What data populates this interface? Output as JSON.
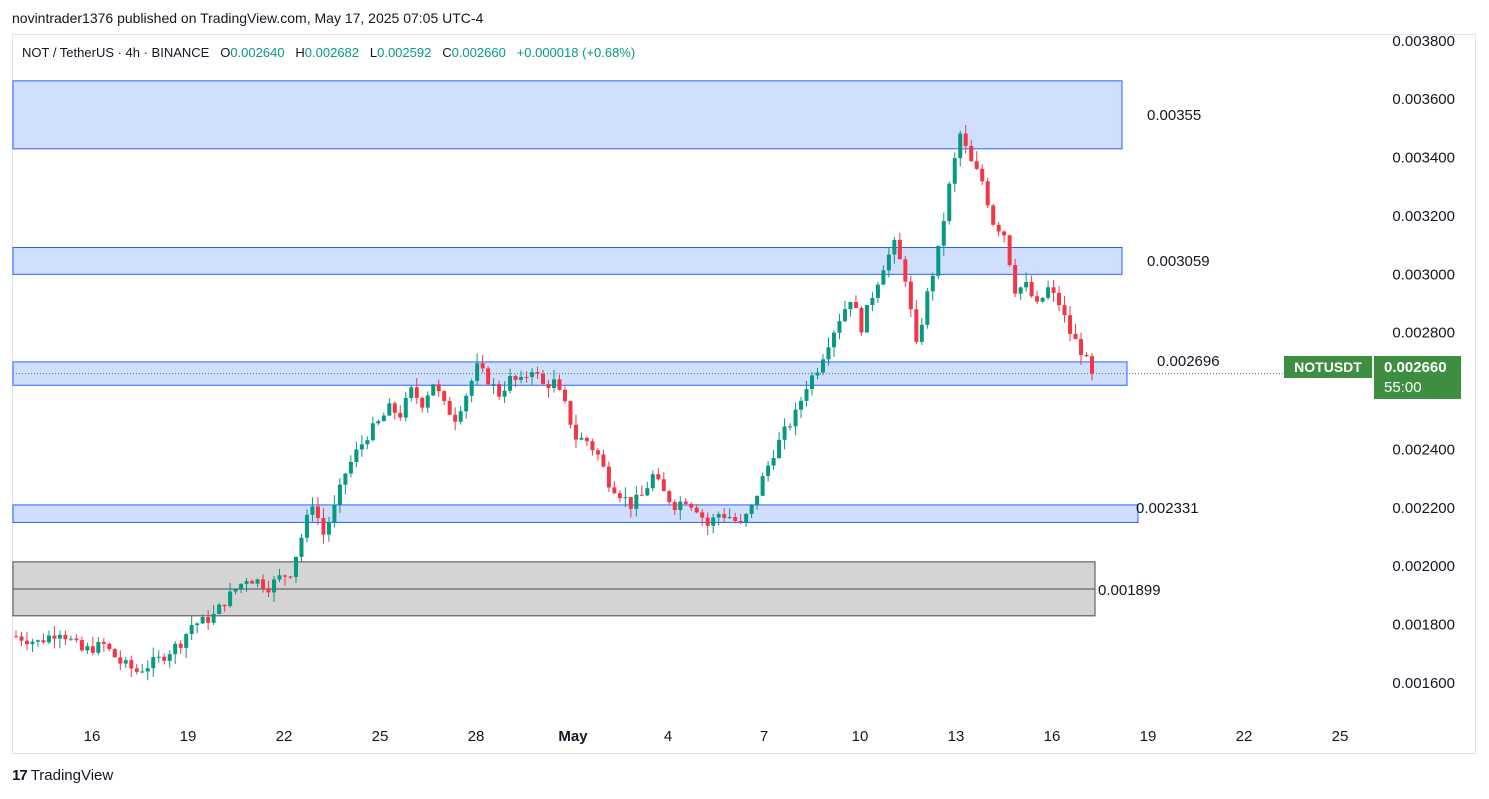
{
  "header": {
    "publisher_line": "novintrader1376 published on TradingView.com, May 17, 2025 07:05 UTC-4"
  },
  "legend": {
    "symbol": "NOT / TetherUS · 4h · BINANCE",
    "o_label": "O",
    "o_value": "0.002640",
    "h_label": "H",
    "h_value": "0.002682",
    "l_label": "L",
    "l_value": "0.002592",
    "c_label": "C",
    "c_value": "0.002660",
    "change": "+0.000018 (+0.68%)"
  },
  "price_badge": {
    "symbol": "NOTUSDT",
    "price": "0.002660",
    "countdown": "55:00"
  },
  "footer": {
    "brand": "TradingView",
    "logo_text": "17"
  },
  "colors": {
    "up": "#089981",
    "down": "#f23645",
    "zone_blue_fill": "#d1dffe",
    "zone_blue_border": "#2962ff",
    "zone_gray_fill": "#d4d4d4",
    "zone_gray_border": "#4a4a4a",
    "badge_bg": "#3e8e41"
  },
  "chart_data": {
    "type": "candlestick",
    "y_axis": {
      "min": 0.00148,
      "max": 0.00382,
      "ticks": [
        "0.001600",
        "0.001800",
        "0.002000",
        "0.002200",
        "0.002400",
        "0.002800",
        "0.003000",
        "0.003200",
        "0.003400",
        "0.003600",
        "0.003800"
      ]
    },
    "x_axis": {
      "ticks": [
        "16",
        "19",
        "22",
        "25",
        "28",
        "May",
        "4",
        "7",
        "10",
        "13",
        "16",
        "19",
        "22",
        "25"
      ]
    },
    "zones": [
      {
        "label": "0.00355",
        "top": 0.003663,
        "bottom": 0.00343,
        "style": "blue"
      },
      {
        "label": "0.003059",
        "top": 0.003092,
        "bottom": 0.003,
        "style": "blue"
      },
      {
        "label": "0.002696",
        "top": 0.0027,
        "bottom": 0.00262,
        "style": "blue"
      },
      {
        "label": "0.002331",
        "top": 0.00221,
        "bottom": 0.00215,
        "style": "blue"
      },
      {
        "label": "0.001899",
        "top": 0.002015,
        "bottom": 0.00183,
        "style": "gray",
        "midline": 0.001922
      }
    ],
    "last_price": 0.00266,
    "path": [
      [
        0,
        0.00176
      ],
      [
        4,
        0.00174
      ],
      [
        8,
        0.00178
      ],
      [
        12,
        0.00171
      ],
      [
        16,
        0.00173
      ],
      [
        19,
        0.00167
      ],
      [
        22,
        0.00164
      ],
      [
        24,
        0.00166
      ],
      [
        26,
        0.00168
      ],
      [
        28,
        0.00171
      ],
      [
        30,
        0.00174
      ],
      [
        32,
        0.0018
      ],
      [
        34,
        0.00181
      ],
      [
        36,
        0.00183
      ],
      [
        38,
        0.00188
      ],
      [
        40,
        0.00192
      ],
      [
        42,
        0.00196
      ],
      [
        44,
        0.00195
      ],
      [
        46,
        0.00193
      ],
      [
        48,
        0.00196
      ],
      [
        50,
        0.00198
      ],
      [
        52,
        0.0021
      ],
      [
        54,
        0.00222
      ],
      [
        56,
        0.00211
      ],
      [
        58,
        0.0022
      ],
      [
        60,
        0.00232
      ],
      [
        62,
        0.00239
      ],
      [
        64,
        0.00245
      ],
      [
        66,
        0.00249
      ],
      [
        68,
        0.00254
      ],
      [
        70,
        0.00252
      ],
      [
        72,
        0.0026
      ],
      [
        74,
        0.00256
      ],
      [
        76,
        0.00263
      ],
      [
        78,
        0.00255
      ],
      [
        80,
        0.00251
      ],
      [
        82,
        0.00259
      ],
      [
        84,
        0.00268
      ],
      [
        86,
        0.00264
      ],
      [
        88,
        0.00259
      ],
      [
        90,
        0.00264
      ],
      [
        92,
        0.00263
      ],
      [
        94,
        0.00268
      ],
      [
        96,
        0.00262
      ],
      [
        98,
        0.00263
      ],
      [
        100,
        0.00255
      ],
      [
        102,
        0.00244
      ],
      [
        104,
        0.00243
      ],
      [
        106,
        0.00238
      ],
      [
        108,
        0.00229
      ],
      [
        110,
        0.00225
      ],
      [
        112,
        0.00221
      ],
      [
        114,
        0.00224
      ],
      [
        116,
        0.00231
      ],
      [
        118,
        0.00225
      ],
      [
        120,
        0.00221
      ],
      [
        122,
        0.00223
      ],
      [
        124,
        0.0022
      ],
      [
        126,
        0.00214
      ],
      [
        128,
        0.00218
      ],
      [
        130,
        0.00217
      ],
      [
        132,
        0.00214
      ],
      [
        134,
        0.0022
      ],
      [
        136,
        0.0023
      ],
      [
        138,
        0.00239
      ],
      [
        140,
        0.00246
      ],
      [
        142,
        0.00252
      ],
      [
        144,
        0.00262
      ],
      [
        146,
        0.00268
      ],
      [
        148,
        0.00277
      ],
      [
        150,
        0.00285
      ],
      [
        152,
        0.00292
      ],
      [
        154,
        0.00282
      ],
      [
        156,
        0.00293
      ],
      [
        158,
        0.00303
      ],
      [
        160,
        0.0031
      ],
      [
        162,
        0.00299
      ],
      [
        164,
        0.00275
      ],
      [
        166,
        0.00293
      ],
      [
        168,
        0.00308
      ],
      [
        170,
        0.0033
      ],
      [
        172,
        0.00348
      ],
      [
        174,
        0.00338
      ],
      [
        176,
        0.00332
      ],
      [
        178,
        0.00318
      ],
      [
        180,
        0.00314
      ],
      [
        182,
        0.00295
      ],
      [
        184,
        0.00296
      ],
      [
        186,
        0.00289
      ],
      [
        188,
        0.00295
      ],
      [
        190,
        0.0029
      ],
      [
        192,
        0.0028
      ],
      [
        194,
        0.00274
      ],
      [
        196,
        0.00266
      ]
    ]
  }
}
